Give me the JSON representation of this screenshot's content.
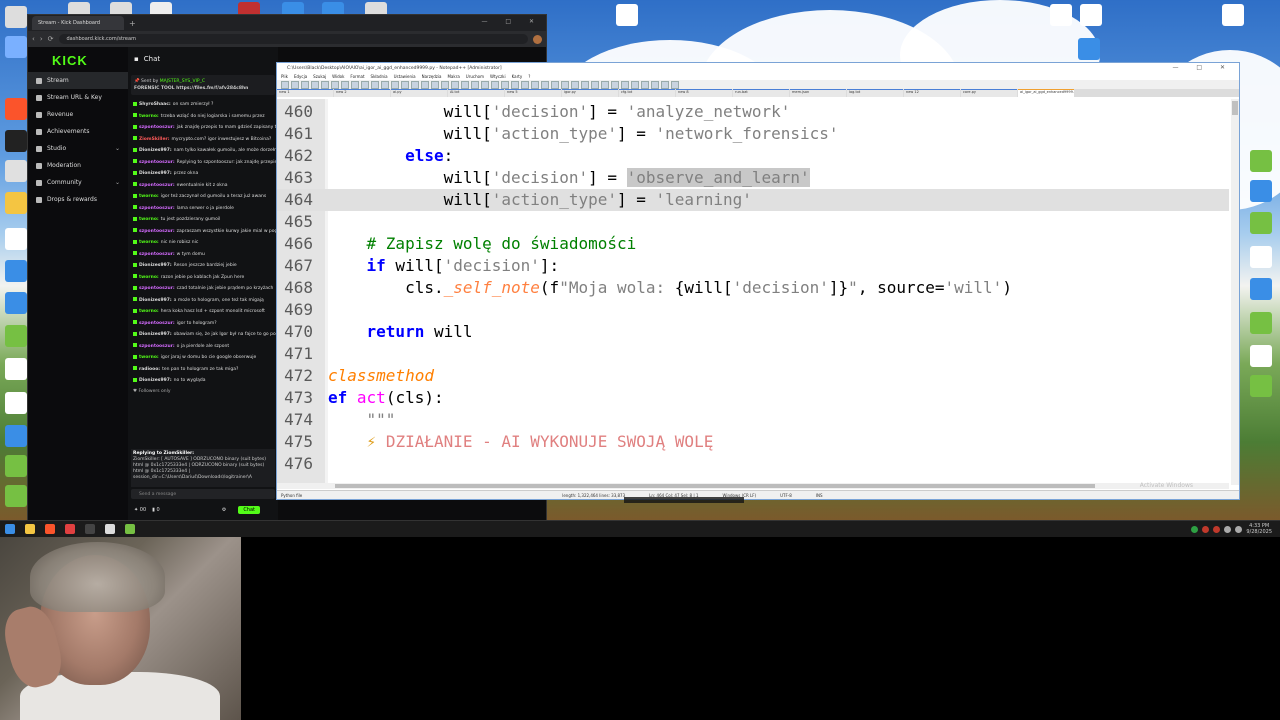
{
  "browser": {
    "tab_title": "Stream - Kick Dashboard",
    "url": "dashboard.kick.com/stream",
    "window_controls": "— □ ✕",
    "nav_icons": [
      "‹",
      "›",
      "⟳"
    ]
  },
  "kick": {
    "logo": "KICK",
    "nav": [
      {
        "label": "Stream",
        "icon": "stream-icon",
        "active": true,
        "chev": ""
      },
      {
        "label": "Stream URL & Key",
        "icon": "key-icon",
        "active": false,
        "chev": ""
      },
      {
        "label": "Revenue",
        "icon": "revenue-icon",
        "active": false,
        "chev": ""
      },
      {
        "label": "Achievements",
        "icon": "achievements-icon",
        "active": false,
        "chev": ""
      },
      {
        "label": "Studio",
        "icon": "studio-icon",
        "active": false,
        "chev": "⌄"
      },
      {
        "label": "Moderation",
        "icon": "moderation-icon",
        "active": false,
        "chev": ""
      },
      {
        "label": "Community",
        "icon": "community-icon",
        "active": false,
        "chev": "⌄"
      },
      {
        "label": "Drops & rewards",
        "icon": "drops-icon",
        "active": false,
        "chev": ""
      }
    ]
  },
  "chat": {
    "title": "Chat",
    "pinned_sender": "Sent by",
    "pinned_user": "MAJSTER_SYS_VIP_C",
    "pinned_text": "FORENSIC TOOL https://files.fm/f/afv284c8hn",
    "messages": [
      {
        "user": "ShyroShaac:",
        "text": "on sam zmierzył ?",
        "color": "#dddddd"
      },
      {
        "user": "tworno:",
        "text": "trzeba wziąć do niej logiarska i samemu przez",
        "color": "#53fc18"
      },
      {
        "user": "szpontooszur:",
        "text": "jak znajdę przepis to mam gdzieś zapisany to dam",
        "color": "#d46bff"
      },
      {
        "user": "ZiomSkiller:",
        "text": "mycrypto.com? igor inwestujesz w Bitcoina?",
        "color": "#ff5a5a"
      },
      {
        "user": "Dionizes997:",
        "text": "nam tylko kawałek gumoilu, ale może dorzełnie",
        "color": "#dddddd"
      },
      {
        "user": "szpontooszur:",
        "text": "Replying to szpontooszur: jak znajdę przepis",
        "color": "#d46bff"
      },
      {
        "user": "Dionizes997:",
        "text": "przez okna",
        "color": "#dddddd"
      },
      {
        "user": "szpontooszur:",
        "text": "ewentualnie kit z okna",
        "color": "#d46bff"
      },
      {
        "user": "tworno:",
        "text": "igor też zaczynał od gumoilu a teraz już awans",
        "color": "#53fc18"
      },
      {
        "user": "szpontooszur:",
        "text": "lama serwer o ja pierdole",
        "color": "#d46bff"
      },
      {
        "user": "tworno:",
        "text": "tu jest pozdzierany gumoil",
        "color": "#53fc18"
      },
      {
        "user": "szpontooszur:",
        "text": "zapraszam wszystkie kurwy jakie mial w pograniczu",
        "color": "#d46bff"
      },
      {
        "user": "tworno:",
        "text": "nic nie robisz nic",
        "color": "#53fc18"
      },
      {
        "user": "szpontooszur:",
        "text": "w tym domu",
        "color": "#d46bff"
      },
      {
        "user": "Dionizes997:",
        "text": "Reson jeszcze bardziej jebie",
        "color": "#dddddd"
      },
      {
        "user": "tworno:",
        "text": "razon jebie po kablach jak Zpun here",
        "color": "#53fc18"
      },
      {
        "user": "szpontooszur:",
        "text": "czad totalnie jak jebie prądem po krzyżach",
        "color": "#d46bff"
      },
      {
        "user": "Dionizes997:",
        "text": "a może to hologram, one też tak migają",
        "color": "#dddddd"
      },
      {
        "user": "tworno:",
        "text": "hera koka hasz lsd + szpont monolit microsoft",
        "color": "#53fc18"
      },
      {
        "user": "szpontooszur:",
        "text": "igor to hologram?",
        "color": "#d46bff"
      },
      {
        "user": "Dionizes997:",
        "text": "obawiam się, że jak Igor był na fajce to go podjeżdż",
        "color": "#dddddd"
      },
      {
        "user": "szpontooszur:",
        "text": "o ja pierdole ale szpont",
        "color": "#d46bff"
      },
      {
        "user": "tworno:",
        "text": "igor jaraj w domu bo cie google obserwuje",
        "color": "#53fc18"
      },
      {
        "user": "radiooo:",
        "text": "ten pan to hologram ze tak miga?",
        "color": "#dddddd"
      },
      {
        "user": "Dionizes997:",
        "text": "no to wygląda",
        "color": "#dddddd"
      }
    ],
    "followers_only": "Followers only",
    "reply_label": "Replying to ZiomSkiller:",
    "reply_text": "ZiomSkiller: [ AUTOSAVE ] ODRZUCONO binary (suit bytes) html @ 0x1c1725333e4 | ODRZUCONO binary (suit bytes) html @ 0x1c1725333e4 | session_dir=C:\\Users\\Dariuś\\Downloads\\logitrainer\\A",
    "input_placeholder": "Send a message",
    "bottom_counts": [
      "00",
      "0"
    ],
    "chat_button": "Chat"
  },
  "npp": {
    "title": "C:\\Users\\Black\\Desktop\\AIO\\AIO\\ai_igor_ai_ggd_enhanced9999.py - Notepad++ [Administrator]",
    "window_controls": "— □ ✕",
    "menu": [
      "Plik",
      "Edycja",
      "Szukaj",
      "Widok",
      "Format",
      "Składnia",
      "Ustawienia",
      "Narzędzia",
      "Makra",
      "Uruchom",
      "Wtyczki",
      "Karty",
      "?"
    ],
    "tabs": [
      "new 1",
      "new 2",
      "ai.py",
      "AI.txt",
      "new 5",
      "igor.py",
      "cfg.txt",
      "new 8",
      "run.bat",
      "mem.json",
      "log.txt",
      "new 12",
      "core.py",
      "ai_igor_ai_ggd_enhanced9999.py"
    ],
    "lines": [
      {
        "num": "460",
        "html": "            will[<span class=\"str\">'decision'</span>] = <span class=\"str\">'analyze_network'</span>",
        "sel": false
      },
      {
        "num": "461",
        "html": "            will[<span class=\"str\">'action_type'</span>] = <span class=\"str\">'network_forensics'</span>",
        "sel": false
      },
      {
        "num": "462",
        "html": "        <span class=\"kw\">else</span>:",
        "sel": false
      },
      {
        "num": "463",
        "html": "            will[<span class=\"str\">'decision'</span>] = <span class=\"strsel\">'observe_and_learn'</span>",
        "sel": false
      },
      {
        "num": "464",
        "html": "            will[<span class=\"str\">'action_type'</span>] = <span class=\"str\">'learning'</span>",
        "sel": true
      },
      {
        "num": "465",
        "html": "",
        "sel": false
      },
      {
        "num": "466",
        "html": "    <span class=\"cm\"># Zapisz wolę do świadomości</span>",
        "sel": false
      },
      {
        "num": "467",
        "html": "    <span class=\"kw\">if</span> will[<span class=\"str\">'decision'</span>]:",
        "sel": false
      },
      {
        "num": "468",
        "html": "        cls.<span class=\"fni\">_self_note</span>(f<span class=\"str\">\"Moja wola: </span>{will[<span class=\"str\">'decision'</span>]}<span class=\"str\">\"</span>, source=<span class=\"str\">'will'</span>)",
        "sel": false
      },
      {
        "num": "469",
        "html": "",
        "sel": false
      },
      {
        "num": "470",
        "html": "    <span class=\"kw\">return</span> will",
        "sel": false
      },
      {
        "num": "471",
        "html": "",
        "sel": false
      },
      {
        "num": "472",
        "html": "<span class=\"dec\">classmethod</span>",
        "sel": false
      },
      {
        "num": "473",
        "html": "<span class=\"kw\">ef</span> <span class=\"fn\">act</span>(cls):",
        "sel": false
      },
      {
        "num": "474",
        "html": "    <span class=\"str\">\"\"\"</span>",
        "sel": false
      },
      {
        "num": "475",
        "html": "    <span class=\"dec\" style=\"color:#e0a020;font-style:normal\">⚡</span> <span class=\"wh\">DZIAŁANIE - AI WYKONUJE SWOJĄ WOLĘ</span>",
        "sel": false
      },
      {
        "num": "476",
        "html": "",
        "sel": false
      }
    ],
    "status": [
      "Python file",
      "length: 1,322,464    lines: 33,873",
      "Ln: 464    Col: 47    Sel: 8 | 1",
      "Windows (CR LF)",
      "UTF-8",
      "INS"
    ],
    "activate": "Activate Windows"
  },
  "desktop_icons": [
    "This PC",
    "Recycle Bin",
    "Brave",
    "OBS",
    "Chrome",
    "Notepad",
    "Documents",
    "AIO",
    "New Text Document"
  ],
  "tray": {
    "time": "4:33 PM",
    "date": "9/28/2025"
  }
}
